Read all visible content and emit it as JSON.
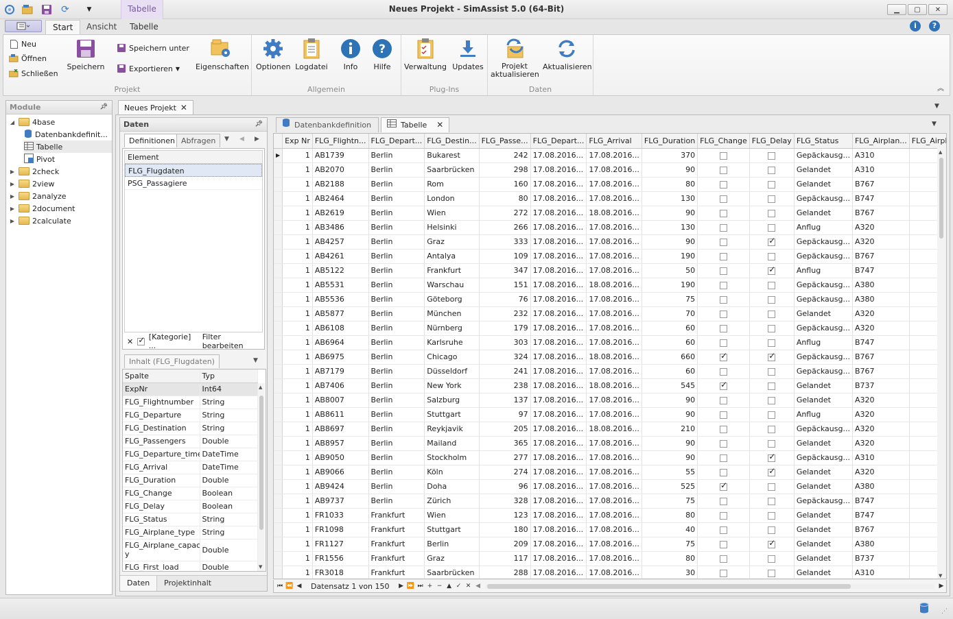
{
  "window": {
    "title": "Neues Projekt - SimAssist 5.0 (64-Bit)",
    "context_tab_header": "Tabelle"
  },
  "ribbon": {
    "tabs": [
      "Start",
      "Ansicht",
      "Tabelle"
    ],
    "groups": {
      "projekt": {
        "label": "Projekt",
        "neu": "Neu",
        "oeffnen": "Öffnen",
        "schliessen": "Schließen",
        "speichern": "Speichern",
        "speichern_unter": "Speichern unter",
        "exportieren": "Exportieren",
        "eigenschaften": "Eigenschaften"
      },
      "allgemein": {
        "label": "Allgemein",
        "optionen": "Optionen",
        "logdatei": "Logdatei",
        "info": "Info",
        "hilfe": "Hilfe"
      },
      "plugins": {
        "label": "Plug-Ins",
        "verwaltung": "Verwaltung",
        "updates": "Updates"
      },
      "daten": {
        "label": "Daten",
        "projekt_aktualisieren_1": "Projekt",
        "projekt_aktualisieren_2": "aktualisieren",
        "aktualisieren": "Aktualisieren"
      }
    }
  },
  "module_panel": {
    "title": "Module",
    "tree": [
      {
        "label": "4base",
        "expanded": true
      },
      {
        "label": "Datenbankdefinit...",
        "child": true
      },
      {
        "label": "Tabelle",
        "child": true
      },
      {
        "label": "Pivot",
        "child": true
      },
      {
        "label": "2check"
      },
      {
        "label": "2view"
      },
      {
        "label": "2analyze"
      },
      {
        "label": "2document"
      },
      {
        "label": "2calculate"
      }
    ]
  },
  "document": {
    "tab": "Neues Projekt",
    "inner_tabs": [
      "Datenbankdefinition",
      "Tabelle"
    ]
  },
  "daten_panel": {
    "title": "Daten",
    "tabs": [
      "Definitionen",
      "Abfragen"
    ],
    "list_header": "Element",
    "items": [
      "FLG_Flugdaten",
      "PSG_Passagiere"
    ],
    "filter_text": "[Kategorie] ...",
    "filter_edit": "Filter bearbeiten",
    "inhalt_tab": "Inhalt (FLG_Flugdaten)",
    "columns_header": [
      "Spalte",
      "Typ"
    ],
    "columns": [
      [
        "ExpNr",
        "Int64"
      ],
      [
        "FLG_Flightnumber",
        "String"
      ],
      [
        "FLG_Departure",
        "String"
      ],
      [
        "FLG_Destination",
        "String"
      ],
      [
        "FLG_Passengers",
        "Double"
      ],
      [
        "FLG_Departure_time",
        "DateTime"
      ],
      [
        "FLG_Arrival",
        "DateTime"
      ],
      [
        "FLG_Duration",
        "Double"
      ],
      [
        "FLG_Change",
        "Boolean"
      ],
      [
        "FLG_Delay",
        "Boolean"
      ],
      [
        "FLG_Status",
        "String"
      ],
      [
        "FLG_Airplane_type",
        "String"
      ],
      [
        "FLG_Airplane_capacit y",
        "Double"
      ],
      [
        "FLG_First_load",
        "Double"
      ]
    ],
    "bottom_tabs": [
      "Daten",
      "Projektinhalt"
    ]
  },
  "grid": {
    "headers": [
      "Exp Nr",
      "FLG_Flightn...",
      "FLG_Depart...",
      "FLG_Destin...",
      "FLG_Passe...",
      "FLG_Depart...",
      "FLG_Arrival",
      "FLG_Duration",
      "FLG_Change",
      "FLG_Delay",
      "FLG_Status",
      "FLG_Airplan...",
      "FLG_Airplan"
    ],
    "rows": [
      [
        1,
        "AB1739",
        "Berlin",
        "Bukarest",
        242,
        "17.08.2016...",
        "17.08.2016...",
        370,
        false,
        false,
        "Gepäckausg...",
        "A310"
      ],
      [
        1,
        "AB2070",
        "Berlin",
        "Saarbrücken",
        298,
        "17.08.2016...",
        "17.08.2016...",
        90,
        false,
        false,
        "Gelandet",
        "A310"
      ],
      [
        1,
        "AB2188",
        "Berlin",
        "Rom",
        160,
        "17.08.2016...",
        "17.08.2016...",
        80,
        false,
        false,
        "Gelandet",
        "B767"
      ],
      [
        1,
        "AB2464",
        "Berlin",
        "London",
        80,
        "17.08.2016...",
        "17.08.2016...",
        130,
        false,
        false,
        "Gepäckausg...",
        "B747"
      ],
      [
        1,
        "AB2619",
        "Berlin",
        "Wien",
        272,
        "17.08.2016...",
        "18.08.2016...",
        90,
        false,
        false,
        "Gelandet",
        "B767"
      ],
      [
        1,
        "AB3486",
        "Berlin",
        "Helsinki",
        266,
        "17.08.2016...",
        "17.08.2016...",
        130,
        false,
        false,
        "Anflug",
        "A320"
      ],
      [
        1,
        "AB4257",
        "Berlin",
        "Graz",
        333,
        "17.08.2016...",
        "17.08.2016...",
        90,
        false,
        true,
        "Gepäckausg...",
        "A320"
      ],
      [
        1,
        "AB4261",
        "Berlin",
        "Antalya",
        109,
        "17.08.2016...",
        "17.08.2016...",
        190,
        false,
        false,
        "Gepäckausg...",
        "B767"
      ],
      [
        1,
        "AB5122",
        "Berlin",
        "Frankfurt",
        347,
        "17.08.2016...",
        "17.08.2016...",
        50,
        false,
        true,
        "Anflug",
        "B747"
      ],
      [
        1,
        "AB5531",
        "Berlin",
        "Warschau",
        151,
        "17.08.2016...",
        "18.08.2016...",
        190,
        false,
        false,
        "Gepäckausg...",
        "A380"
      ],
      [
        1,
        "AB5536",
        "Berlin",
        "Göteborg",
        76,
        "17.08.2016...",
        "17.08.2016...",
        75,
        false,
        false,
        "Gepäckausg...",
        "A380"
      ],
      [
        1,
        "AB5877",
        "Berlin",
        "München",
        232,
        "17.08.2016...",
        "17.08.2016...",
        70,
        false,
        false,
        "Gelandet",
        "A320"
      ],
      [
        1,
        "AB6108",
        "Berlin",
        "Nürnberg",
        179,
        "17.08.2016...",
        "17.08.2016...",
        60,
        false,
        false,
        "Gepäckausg...",
        "A320"
      ],
      [
        1,
        "AB6964",
        "Berlin",
        "Karlsruhe",
        303,
        "17.08.2016...",
        "17.08.2016...",
        60,
        false,
        false,
        "Anflug",
        "B747"
      ],
      [
        1,
        "AB6975",
        "Berlin",
        "Chicago",
        324,
        "17.08.2016...",
        "18.08.2016...",
        660,
        true,
        true,
        "Gepäckausg...",
        "B767"
      ],
      [
        1,
        "AB7179",
        "Berlin",
        "Düsseldorf",
        241,
        "17.08.2016...",
        "17.08.2016...",
        60,
        false,
        false,
        "Gepäckausg...",
        "B767"
      ],
      [
        1,
        "AB7406",
        "Berlin",
        "New York",
        238,
        "17.08.2016...",
        "18.08.2016...",
        545,
        true,
        false,
        "Gelandet",
        "B737"
      ],
      [
        1,
        "AB8007",
        "Berlin",
        "Salzburg",
        137,
        "17.08.2016...",
        "17.08.2016...",
        90,
        false,
        false,
        "Gelandet",
        "A320"
      ],
      [
        1,
        "AB8611",
        "Berlin",
        "Stuttgart",
        97,
        "17.08.2016...",
        "17.08.2016...",
        90,
        false,
        false,
        "Anflug",
        "A320"
      ],
      [
        1,
        "AB8697",
        "Berlin",
        "Reykjavik",
        205,
        "17.08.2016...",
        "18.08.2016...",
        210,
        false,
        false,
        "Gepäckausg...",
        "A320"
      ],
      [
        1,
        "AB8957",
        "Berlin",
        "Mailand",
        365,
        "17.08.2016...",
        "17.08.2016...",
        90,
        false,
        false,
        "Gelandet",
        "A320"
      ],
      [
        1,
        "AB9050",
        "Berlin",
        "Stockholm",
        277,
        "17.08.2016...",
        "17.08.2016...",
        90,
        false,
        true,
        "Gepäckausg...",
        "A310"
      ],
      [
        1,
        "AB9066",
        "Berlin",
        "Köln",
        274,
        "17.08.2016...",
        "17.08.2016...",
        55,
        false,
        true,
        "Gelandet",
        "A320"
      ],
      [
        1,
        "AB9424",
        "Berlin",
        "Doha",
        96,
        "17.08.2016...",
        "17.08.2016...",
        525,
        true,
        false,
        "Gelandet",
        "A380"
      ],
      [
        1,
        "AB9737",
        "Berlin",
        "Zürich",
        328,
        "17.08.2016...",
        "17.08.2016...",
        75,
        false,
        false,
        "Gepäckausg...",
        "B747"
      ],
      [
        1,
        "FR1033",
        "Frankfurt",
        "Wien",
        123,
        "17.08.2016...",
        "17.08.2016...",
        80,
        false,
        false,
        "Gelandet",
        "B747"
      ],
      [
        1,
        "FR1098",
        "Frankfurt",
        "Stuttgart",
        180,
        "17.08.2016...",
        "17.08.2016...",
        40,
        false,
        false,
        "Gelandet",
        "B767"
      ],
      [
        1,
        "FR1127",
        "Frankfurt",
        "Berlin",
        209,
        "17.08.2016...",
        "17.08.2016...",
        75,
        false,
        true,
        "Gelandet",
        "A380"
      ],
      [
        1,
        "FR1556",
        "Frankfurt",
        "Graz",
        117,
        "17.08.2016...",
        "17.08.2016...",
        80,
        false,
        false,
        "Gelandet",
        "B737"
      ],
      [
        1,
        "FR3018",
        "Frankfurt",
        "Saarbrücken",
        288,
        "17.08.2016...",
        "17.08.2016...",
        30,
        false,
        false,
        "Gelandet",
        "A310"
      ]
    ],
    "record_text": "Datensatz 1 von 150"
  }
}
